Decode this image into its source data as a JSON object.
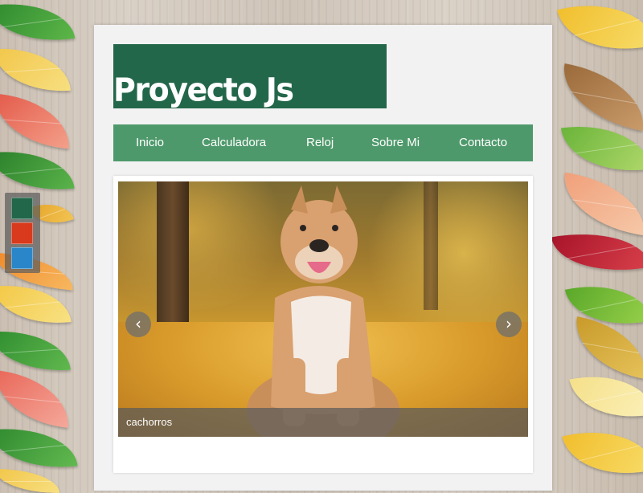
{
  "site": {
    "title": "Proyecto Js"
  },
  "nav": {
    "items": [
      {
        "label": "Inicio"
      },
      {
        "label": "Calculadora"
      },
      {
        "label": "Reloj"
      },
      {
        "label": "Sobre Mi"
      },
      {
        "label": "Contacto"
      }
    ]
  },
  "slider": {
    "caption": "cachorros",
    "prev_icon": "chevron-left-icon",
    "next_icon": "chevron-right-icon"
  },
  "theme_switcher": {
    "colors": [
      "#23674a",
      "#d9391c",
      "#2a86c9"
    ]
  },
  "colors": {
    "brand_dark": "#23674a",
    "nav_green": "#4e996b",
    "panel_bg": "#f2f2f3"
  }
}
